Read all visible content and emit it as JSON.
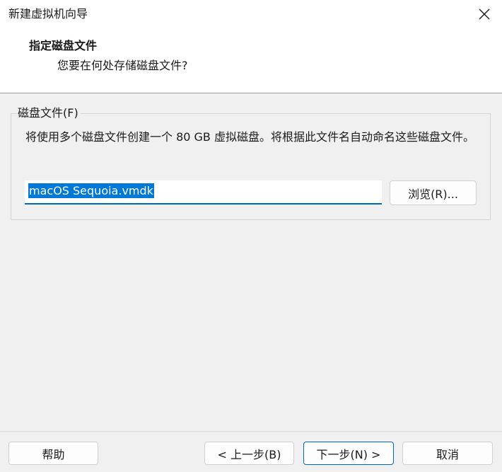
{
  "window": {
    "title": "新建虚拟机向导",
    "close_icon": "close-icon"
  },
  "header": {
    "title": "指定磁盘文件",
    "subtitle": "您要在何处存储磁盘文件?"
  },
  "disk_file_group": {
    "label": "磁盘文件(F)",
    "description": "将使用多个磁盘文件创建一个 80 GB 虚拟磁盘。将根据此文件名自动命名这些磁盘文件。",
    "filename": "macOS Sequoia.vmdk",
    "browse_label": "浏览(R)..."
  },
  "footer": {
    "help_label": "帮助",
    "back_label": "< 上一步(B)",
    "next_label": "下一步(N) >",
    "cancel_label": "取消"
  },
  "colors": {
    "accent": "#0067c0",
    "selection": "#0078d7"
  }
}
